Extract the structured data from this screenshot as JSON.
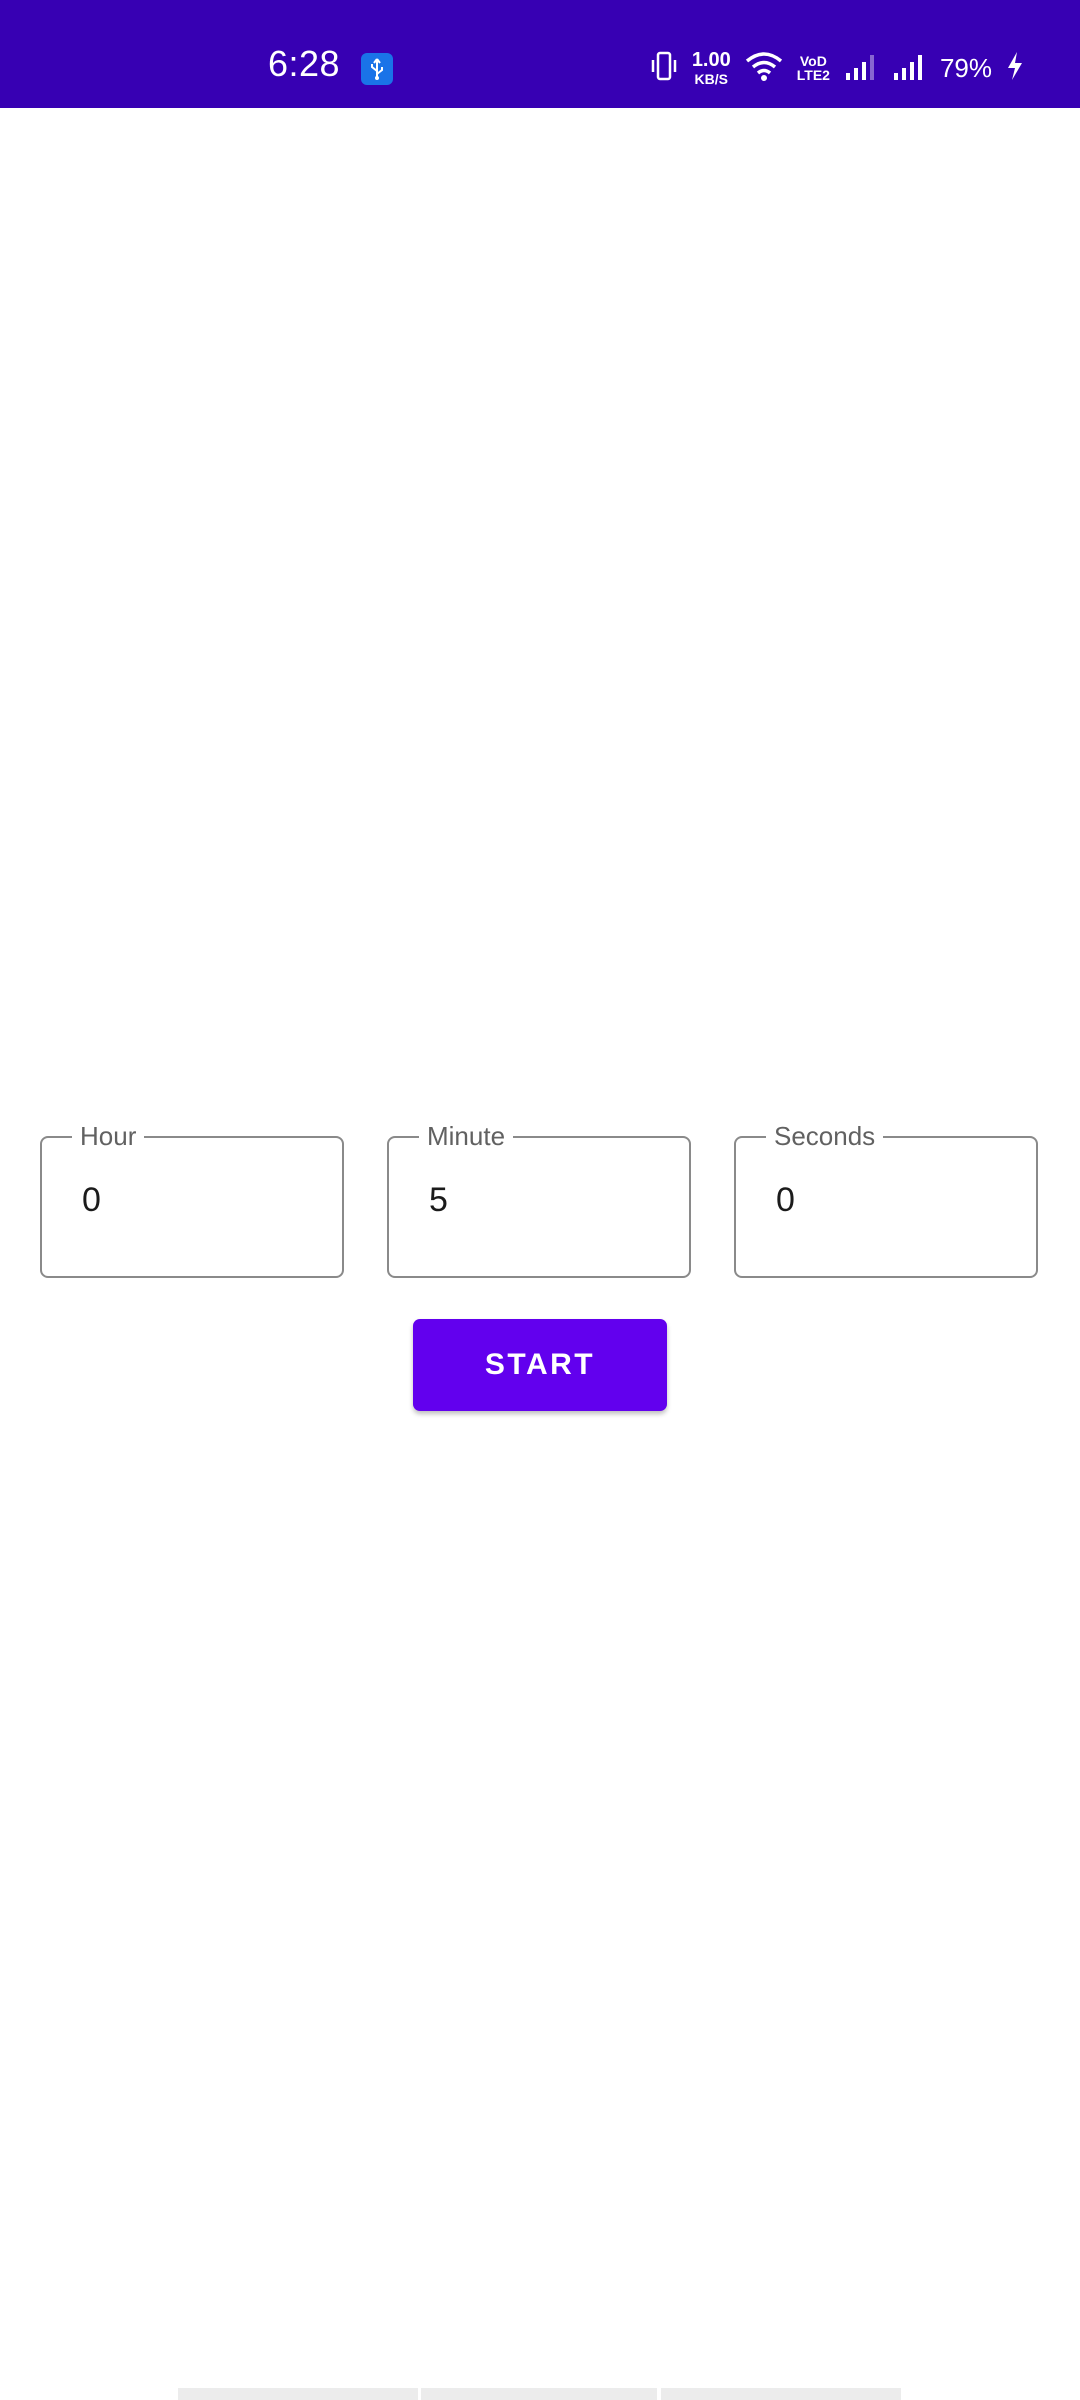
{
  "status_bar": {
    "time": "6:28",
    "net_speed_value": "1.00",
    "net_speed_unit": "KB/S",
    "volte_top": "VoD",
    "volte_bottom": "LTE2",
    "battery": "79%",
    "background": "#3700b3",
    "icons": [
      "usb-icon",
      "vibrate-icon",
      "wifi-icon",
      "signal-icon",
      "signal-icon",
      "charging-icon"
    ]
  },
  "timer": {
    "hour": {
      "label": "Hour",
      "value": "0"
    },
    "minute": {
      "label": "Minute",
      "value": "5"
    },
    "seconds": {
      "label": "Seconds",
      "value": "0"
    }
  },
  "start_button": {
    "label": "START",
    "color": "#6200ee"
  }
}
